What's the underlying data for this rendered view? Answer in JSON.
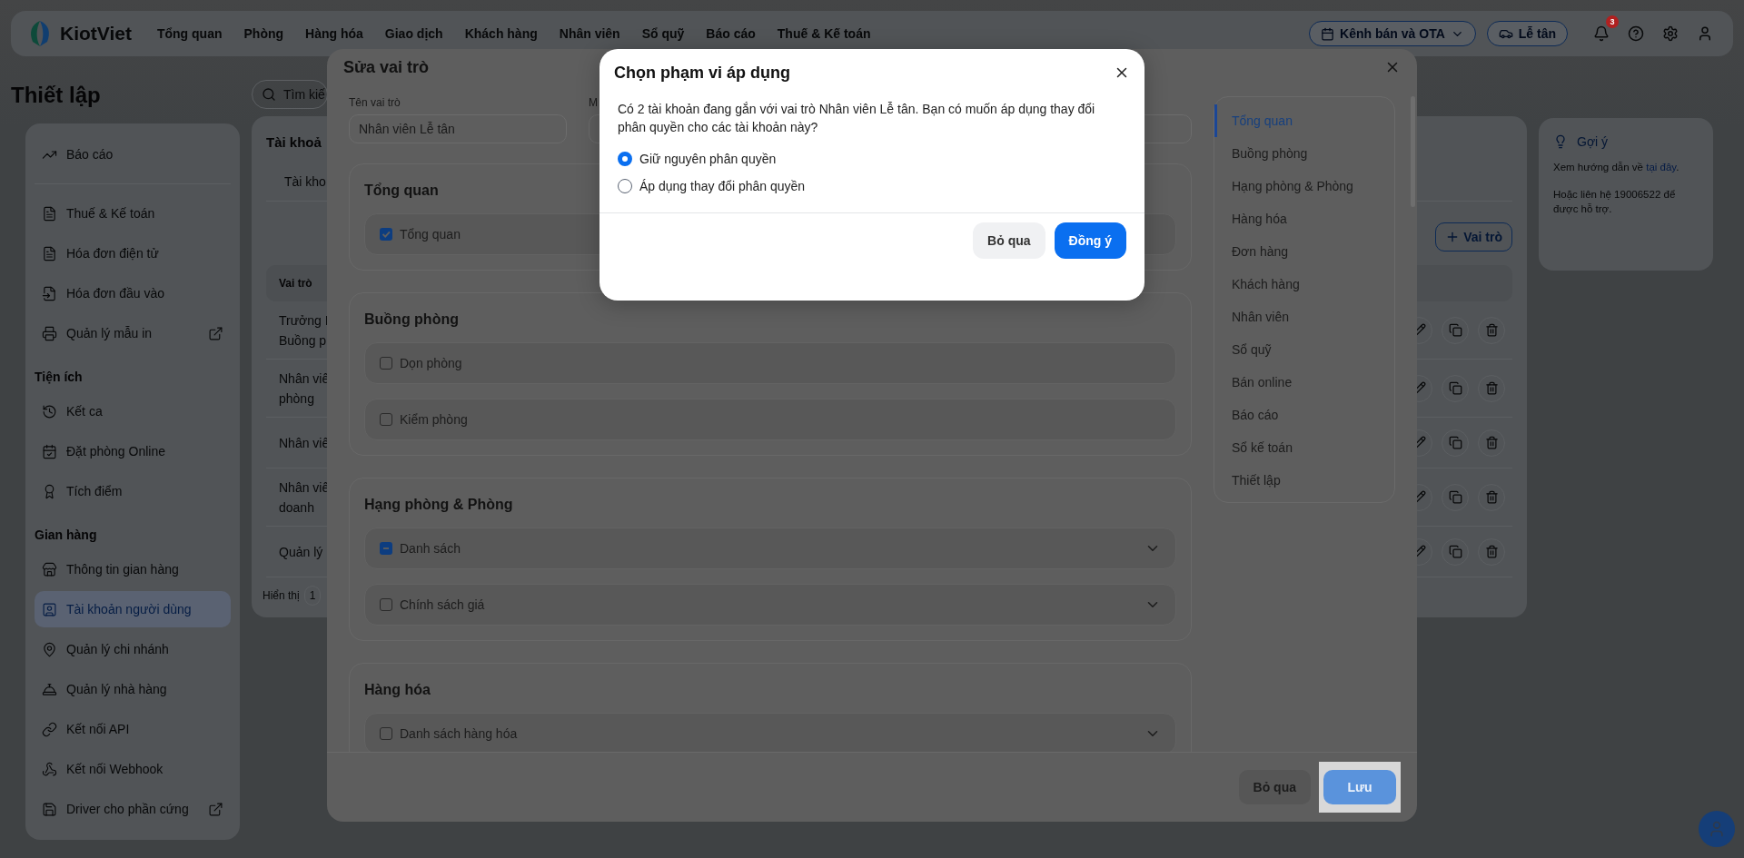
{
  "top_nav": {
    "logo": "KiotViet",
    "items": [
      "Tổng quan",
      "Phòng",
      "Hàng hóa",
      "Giao dịch",
      "Khách hàng",
      "Nhân viên",
      "Sổ quỹ",
      "Báo cáo",
      "Thuế & Kế toán"
    ],
    "channel_button": "Kênh bán và OTA",
    "reception_button": "Lễ tân",
    "notification_count": "3"
  },
  "page": {
    "title": "Thiết lập",
    "search": {
      "placeholder": "Tìm kiế"
    }
  },
  "sidebar": {
    "groups": [
      {
        "items": [
          {
            "label": "Báo cáo",
            "selected": false,
            "external": false
          }
        ]
      },
      {
        "items": [
          {
            "label": "Thuế & Kế toán",
            "selected": false,
            "external": false
          },
          {
            "label": "Hóa đơn điện tử",
            "selected": false,
            "external": false
          },
          {
            "label": "Hóa đơn đầu vào",
            "selected": false,
            "external": false
          },
          {
            "label": "Quản lý mẫu in",
            "selected": false,
            "external": true
          }
        ]
      },
      {
        "title": "Tiện ích",
        "items": [
          {
            "label": "Kết ca",
            "selected": false,
            "external": false
          },
          {
            "label": "Đặt phòng Online",
            "selected": false,
            "external": false
          },
          {
            "label": "Tích điểm",
            "selected": false,
            "external": false
          }
        ]
      },
      {
        "title": "Gian hàng",
        "items": [
          {
            "label": "Thông tin gian hàng",
            "selected": false,
            "external": false
          },
          {
            "label": "Tài khoản người dùng",
            "selected": true,
            "external": false
          },
          {
            "label": "Quản lý chi nhánh",
            "selected": false,
            "external": false
          },
          {
            "label": "Quản lý nhà hàng",
            "selected": false,
            "external": false
          },
          {
            "label": "Kết nối API",
            "selected": false,
            "external": false
          },
          {
            "label": "Kết nối Webhook",
            "selected": false,
            "external": false
          },
          {
            "label": "Driver cho phần cứng",
            "selected": false,
            "external": true
          }
        ]
      }
    ]
  },
  "accounts_panel": {
    "title": "Tài khoả",
    "tab": "Tài kho",
    "add_button": "Vai trò",
    "table": {
      "header": "Vai trò",
      "rows": [
        {
          "lines": [
            "Trưởng I",
            "Buồng p"
          ]
        },
        {
          "lines": [
            "Nhân viê",
            "phòng"
          ]
        },
        {
          "lines": [
            "Nhân viê"
          ]
        },
        {
          "lines": [
            "Nhân viê",
            "doanh"
          ]
        },
        {
          "lines": [
            "Quản lý"
          ]
        }
      ]
    },
    "footer": {
      "label": "Hiển thị",
      "page_size": "1"
    }
  },
  "hint": {
    "title": "Gợi ý",
    "text": "Xem hướng dẫn về ",
    "link": "tại đây",
    "text_end": ".",
    "contact": "Hoặc liên hệ 19006522 để được hỗ trợ."
  },
  "edit_modal": {
    "title": "Sửa vai trò",
    "fields": [
      {
        "label": "Tên vai trò",
        "value": "Nhân viên Lễ tân"
      },
      {
        "label": "M"
      }
    ],
    "sections": [
      {
        "title": "Tổng quan",
        "items": [
          {
            "label": "Tổng quan",
            "checked": true,
            "indeterminate": false,
            "expandable": false
          }
        ]
      },
      {
        "title": "Buồng phòng",
        "items": [
          {
            "label": "Dọn phòng",
            "checked": false,
            "indeterminate": false,
            "expandable": false
          },
          {
            "label": "Kiểm phòng",
            "checked": false,
            "indeterminate": false,
            "expandable": false
          }
        ]
      },
      {
        "title": "Hạng phòng & Phòng",
        "items": [
          {
            "label": "Danh sách",
            "checked": false,
            "indeterminate": true,
            "expandable": true
          },
          {
            "label": "Chính sách giá",
            "checked": false,
            "indeterminate": false,
            "expandable": true
          }
        ]
      },
      {
        "title": "Hàng hóa",
        "items": [
          {
            "label": "Danh sách hàng hóa",
            "checked": false,
            "indeterminate": false,
            "expandable": true
          }
        ]
      }
    ],
    "nav": [
      {
        "label": "Tổng quan",
        "selected": true
      },
      {
        "label": "Buồng phòng",
        "selected": false
      },
      {
        "label": "Hạng phòng & Phòng",
        "selected": false
      },
      {
        "label": "Hàng hóa",
        "selected": false
      },
      {
        "label": "Đơn hàng",
        "selected": false
      },
      {
        "label": "Khách hàng",
        "selected": false
      },
      {
        "label": "Nhân viên",
        "selected": false
      },
      {
        "label": "Sổ quỹ",
        "selected": false
      },
      {
        "label": "Bán online",
        "selected": false
      },
      {
        "label": "Báo cáo",
        "selected": false
      },
      {
        "label": "Sổ kế toán",
        "selected": false
      },
      {
        "label": "Thiết lập",
        "selected": false
      }
    ],
    "cancel_button": "Bỏ qua",
    "save_button": "Lưu"
  },
  "scope_dialog": {
    "title": "Chọn phạm vi áp dụng",
    "message": "Có 2 tài khoản đang gắn với vai trò Nhân viên Lễ tân. Bạn có muốn áp dụng thay đổi phân quyền cho các tài khoản này?",
    "options": [
      {
        "label": "Giữ nguyên phân quyền",
        "selected": true
      },
      {
        "label": "Áp dụng thay đổi phân quyền",
        "selected": false
      }
    ],
    "cancel_button": "Bỏ qua",
    "confirm_button": "Đồng ý"
  }
}
